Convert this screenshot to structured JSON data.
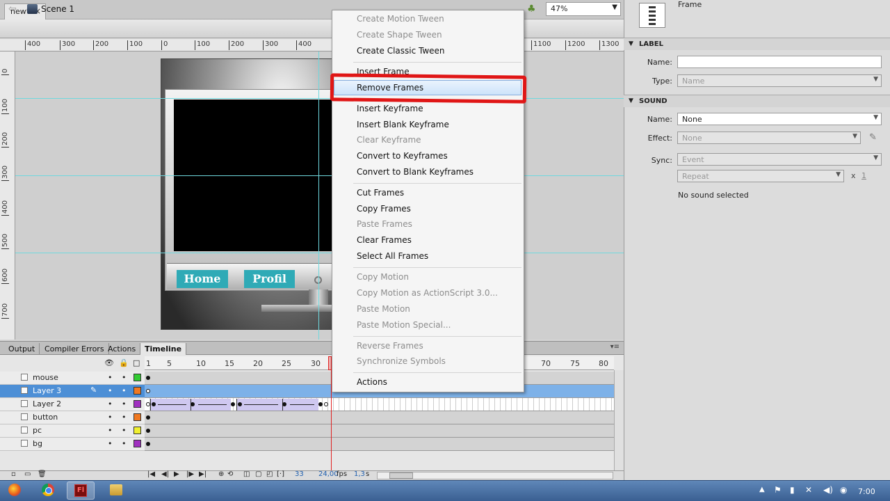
{
  "document": {
    "tab_title": "new*",
    "close_glyph": "×"
  },
  "edit_bar": {
    "scene_label": "Scene 1",
    "zoom_value": "47%"
  },
  "ruler_top": [
    "400",
    "300",
    "200",
    "100",
    "0",
    "100",
    "200",
    "300",
    "400",
    "1100",
    "1200",
    "1300"
  ],
  "ruler_left": [
    "0",
    "100",
    "200",
    "300",
    "400",
    "500",
    "600",
    "700"
  ],
  "stage_buttons": {
    "home": "Home",
    "profil": "Profil"
  },
  "panel_tabs": [
    "Output",
    "Compiler Errors",
    "Actions",
    "Timeline"
  ],
  "timeline": {
    "frame_numbers": [
      "1",
      "5",
      "10",
      "15",
      "20",
      "25",
      "30",
      "70",
      "75",
      "80"
    ],
    "layers": [
      {
        "name": "mouse",
        "color": "#33cc33"
      },
      {
        "name": "Layer 3",
        "color": "#f07820"
      },
      {
        "name": "Layer 2",
        "color": "#a030c0"
      },
      {
        "name": "button",
        "color": "#f07820"
      },
      {
        "name": "pc",
        "color": "#f0f030"
      },
      {
        "name": "bg",
        "color": "#a030c0"
      }
    ],
    "current_frame": "33",
    "fps": "24,00",
    "fps_unit": "fps",
    "time": "1,3",
    "time_unit": "s"
  },
  "properties": {
    "frame_label": "Frame",
    "label_section": "LABEL",
    "name_label": "Name:",
    "name_value": "",
    "type_label": "Type:",
    "type_value": "Name",
    "sound_section": "SOUND",
    "sound_name_label": "Name:",
    "sound_name_value": "None",
    "effect_label": "Effect:",
    "effect_value": "None",
    "sync_label": "Sync:",
    "sync_value": "Event",
    "repeat_value": "Repeat",
    "repeat_x": "x",
    "repeat_count": "1",
    "no_sound_text": "No sound selected"
  },
  "context_menu": {
    "items": [
      {
        "label": "Create Motion Tween",
        "enabled": false
      },
      {
        "label": "Create Shape Tween",
        "enabled": false
      },
      {
        "label": "Create Classic Tween",
        "enabled": true
      },
      {
        "label": "Insert Frame",
        "enabled": true
      },
      {
        "label": "Remove Frames",
        "enabled": true,
        "highlighted": true
      },
      {
        "label": "Insert Keyframe",
        "enabled": true
      },
      {
        "label": "Insert Blank Keyframe",
        "enabled": true
      },
      {
        "label": "Clear Keyframe",
        "enabled": false
      },
      {
        "label": "Convert to Keyframes",
        "enabled": true
      },
      {
        "label": "Convert to Blank Keyframes",
        "enabled": true
      },
      {
        "label": "Cut Frames",
        "enabled": true
      },
      {
        "label": "Copy Frames",
        "enabled": true
      },
      {
        "label": "Paste Frames",
        "enabled": false
      },
      {
        "label": "Clear Frames",
        "enabled": true
      },
      {
        "label": "Select All Frames",
        "enabled": true
      },
      {
        "label": "Copy Motion",
        "enabled": false
      },
      {
        "label": "Copy Motion as ActionScript 3.0...",
        "enabled": false
      },
      {
        "label": "Paste Motion",
        "enabled": false
      },
      {
        "label": "Paste Motion Special...",
        "enabled": false
      },
      {
        "label": "Reverse Frames",
        "enabled": false
      },
      {
        "label": "Synchronize Symbols",
        "enabled": false
      },
      {
        "label": "Actions",
        "enabled": true
      }
    ]
  },
  "taskbar": {
    "clock": "7:00"
  }
}
